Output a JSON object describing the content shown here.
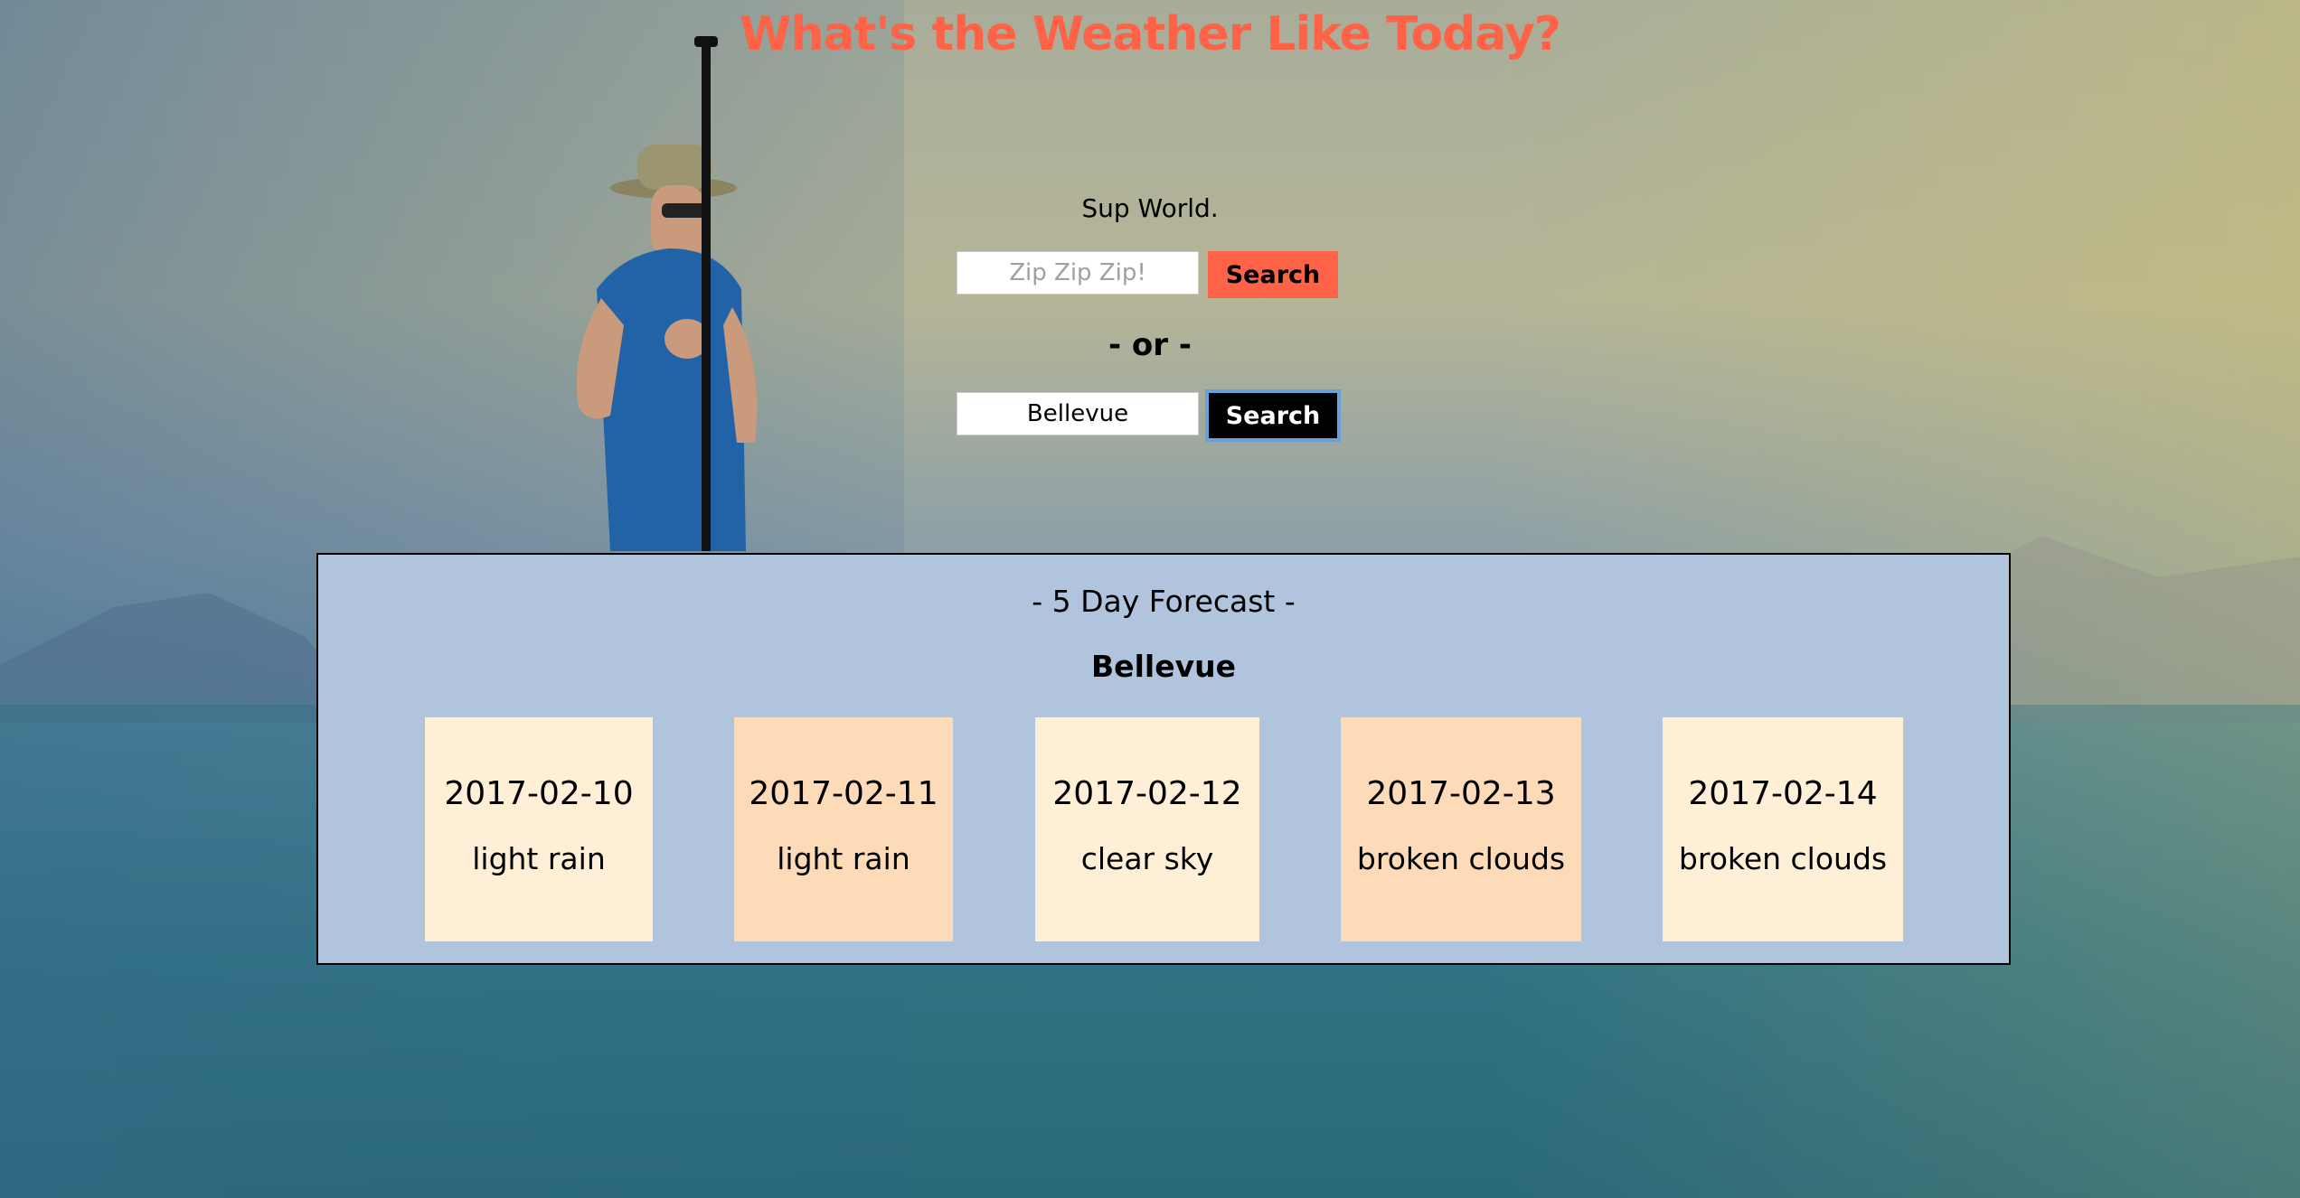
{
  "header": {
    "title": "What's the Weather Like Today?"
  },
  "greeting": "Sup World.",
  "zip_search": {
    "placeholder": "Zip Zip Zip!",
    "value": "",
    "button_label": "Search"
  },
  "separator": "- or -",
  "city_search": {
    "placeholder": "",
    "value": "Bellevue",
    "button_label": "Search"
  },
  "forecast": {
    "title": "- 5 Day Forecast -",
    "city": "Bellevue",
    "days": [
      {
        "date": "2017-02-10",
        "description": "light rain"
      },
      {
        "date": "2017-02-11",
        "description": "light rain"
      },
      {
        "date": "2017-02-12",
        "description": "clear sky"
      },
      {
        "date": "2017-02-13",
        "description": "broken clouds"
      },
      {
        "date": "2017-02-14",
        "description": "broken clouds"
      }
    ]
  },
  "colors": {
    "title": "#ff6347",
    "zip_button": "#ff6347",
    "city_button": "#000000",
    "forecast_panel": "#b0c4de",
    "card_light": "#feefd6",
    "card_dark": "#fddbb8"
  }
}
